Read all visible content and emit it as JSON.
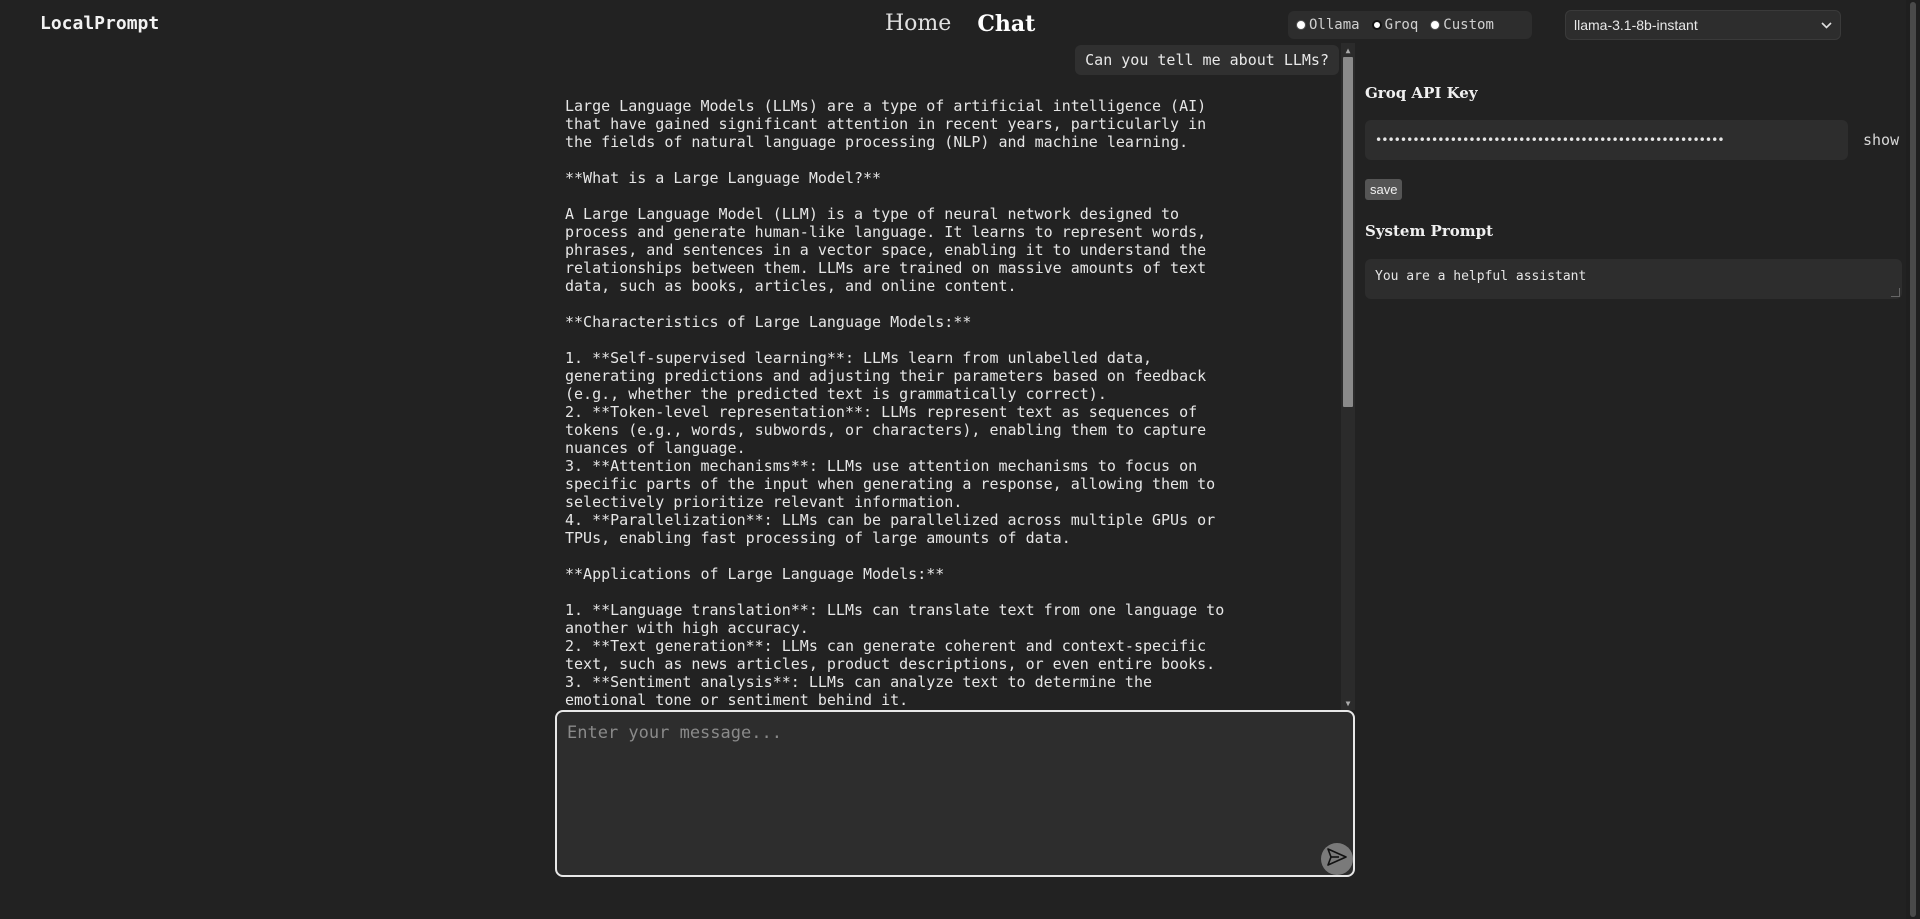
{
  "app": {
    "brand": "LocalPrompt"
  },
  "nav": {
    "home": "Home",
    "chat": "Chat"
  },
  "providers": {
    "options": [
      "Ollama",
      "Groq",
      "Custom"
    ],
    "selected": "Groq"
  },
  "model_select": {
    "value": "llama-3.1-8b-instant"
  },
  "chat": {
    "user_message": "Can you tell me about LLMs?",
    "assistant_message": "Large Language Models (LLMs) are a type of artificial intelligence (AI)\nthat have gained significant attention in recent years, particularly in\nthe fields of natural language processing (NLP) and machine learning.\n\n**What is a Large Language Model?**\n\nA Large Language Model (LLM) is a type of neural network designed to\nprocess and generate human-like language. It learns to represent words,\nphrases, and sentences in a vector space, enabling it to understand the\nrelationships between them. LLMs are trained on massive amounts of text\ndata, such as books, articles, and online content.\n\n**Characteristics of Large Language Models:**\n\n1. **Self-supervised learning**: LLMs learn from unlabelled data,\ngenerating predictions and adjusting their parameters based on feedback\n(e.g., whether the predicted text is grammatically correct).\n2. **Token-level representation**: LLMs represent text as sequences of\ntokens (e.g., words, subwords, or characters), enabling them to capture\nnuances of language.\n3. **Attention mechanisms**: LLMs use attention mechanisms to focus on\nspecific parts of the input when generating a response, allowing them to\nselectively prioritize relevant information.\n4. **Parallelization**: LLMs can be parallelized across multiple GPUs or\nTPUs, enabling fast processing of large amounts of data.\n\n**Applications of Large Language Models:**\n\n1. **Language translation**: LLMs can translate text from one language to\nanother with high accuracy.\n2. **Text generation**: LLMs can generate coherent and context-specific\ntext, such as news articles, product descriptions, or even entire books.\n3. **Sentiment analysis**: LLMs can analyze text to determine the\nemotional tone or sentiment behind it.",
    "composer_placeholder": "Enter your message..."
  },
  "settings": {
    "api_key_label": "Groq API Key",
    "api_key_value": "••••••••••••••••••••••••••••••••••••••••••••••••••••••••",
    "show_label": "show",
    "save_label": "save",
    "system_prompt_label": "System Prompt",
    "system_prompt_value": "You are a helpful assistant"
  }
}
